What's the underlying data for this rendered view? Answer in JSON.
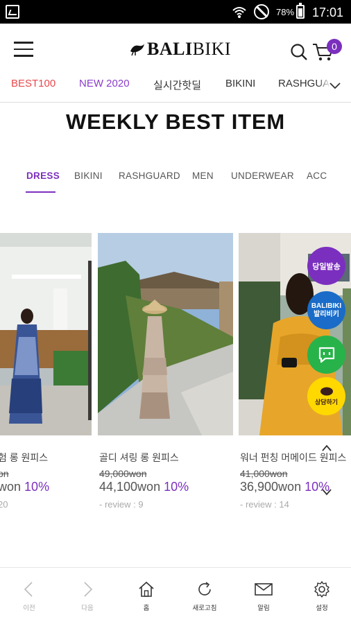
{
  "status_bar": {
    "battery_percent": "78%",
    "time": "17:01"
  },
  "header": {
    "logo_bold": "BALI",
    "logo_light": "BIKI",
    "cart_count": "0"
  },
  "category_nav": {
    "items": [
      {
        "label": "BEST100"
      },
      {
        "label": "NEW 2020"
      },
      {
        "label": "실시간핫딜"
      },
      {
        "label": "BIKINI"
      },
      {
        "label": "RASHGUARD"
      }
    ]
  },
  "section": {
    "title": "WEEKLY BEST ITEM"
  },
  "tabs": {
    "items": [
      {
        "label": "DRESS"
      },
      {
        "label": "BIKINI"
      },
      {
        "label": "RASHGUARD"
      },
      {
        "label": "MEN"
      },
      {
        "label": "UNDERWEAR"
      },
      {
        "label": "ACC"
      }
    ],
    "active": "DRESS"
  },
  "products": [
    {
      "name": "험 롱 원피스",
      "original_price": "on",
      "price": "won",
      "discount": "10%",
      "review": "20"
    },
    {
      "name": "골디 셔링 롱 원피스",
      "original_price": "49,000won",
      "price": "44,100won",
      "discount": "10%",
      "review": "- review : 9"
    },
    {
      "name": "워너 펀칭 머메이드 원피스",
      "original_price": "41,000won",
      "price": "36,900won",
      "discount": "10%",
      "review": "- review : 14"
    }
  ],
  "floating": {
    "same_day": "당일발송",
    "balibiki_top": "BALIBIKI",
    "balibiki_bottom": "발리비키",
    "kakao": "상담하기"
  },
  "bottom_bar": {
    "items": [
      {
        "label": "이전",
        "icon": "chevron-left-icon"
      },
      {
        "label": "다음",
        "icon": "chevron-right-icon"
      },
      {
        "label": "홈",
        "icon": "home-icon"
      },
      {
        "label": "새로고침",
        "icon": "refresh-icon"
      },
      {
        "label": "알림",
        "icon": "mail-icon"
      },
      {
        "label": "설정",
        "icon": "gear-icon"
      }
    ]
  },
  "colors": {
    "accent_purple": "#7b2fbe",
    "best_red": "#e8484d",
    "status_bar": "#000000"
  }
}
